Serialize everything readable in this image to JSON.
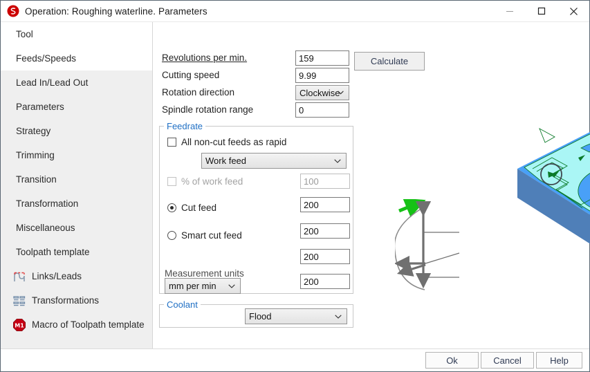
{
  "window": {
    "title": "Operation: Roughing waterline. Parameters",
    "icon": "app-logo-icon",
    "minimize": "–",
    "maximize": "□",
    "close": "✕"
  },
  "sidebar": {
    "items": [
      {
        "label": "Tool",
        "selected": false,
        "icon": null
      },
      {
        "label": "Feeds/Speeds",
        "selected": true,
        "icon": null
      },
      {
        "label": "Lead In/Lead Out",
        "selected": false,
        "icon": null
      },
      {
        "label": "Parameters",
        "selected": false,
        "icon": null
      },
      {
        "label": "Strategy",
        "selected": false,
        "icon": null
      },
      {
        "label": "Trimming",
        "selected": false,
        "icon": null
      },
      {
        "label": "Transition",
        "selected": false,
        "icon": null
      },
      {
        "label": "Transformation",
        "selected": false,
        "icon": null
      },
      {
        "label": "Miscellaneous",
        "selected": false,
        "icon": null
      },
      {
        "label": "Toolpath template",
        "selected": false,
        "icon": null
      },
      {
        "label": "Links/Leads",
        "selected": false,
        "icon": "links-leads-icon"
      },
      {
        "label": "Transformations",
        "selected": false,
        "icon": "transformations-icon"
      },
      {
        "label": "Macro of Toolpath template",
        "selected": false,
        "icon": "macro-m1-icon"
      }
    ]
  },
  "spindle": {
    "rpm_label": "Revolutions per min.",
    "rpm_value": "159",
    "cutting_speed_label": "Cutting speed",
    "cutting_speed_value": "9.99",
    "rotation_direction_label": "Rotation direction",
    "rotation_direction_value": "Clockwise",
    "spindle_range_label": "Spindle rotation range",
    "spindle_range_value": "0",
    "calculate_label": "Calculate"
  },
  "feedrate": {
    "group_title": "Feedrate",
    "all_non_cut_label": "All non-cut feeds as rapid",
    "all_non_cut_checked": false,
    "feed_type_value": "Work feed",
    "percent_of_work_feed_label": "% of work feed",
    "percent_of_work_feed_checked": false,
    "percent_of_work_feed_value": "100",
    "cut_feed_label": "Cut feed",
    "cut_feed_selected": true,
    "smart_cut_feed_label": "Smart cut feed",
    "smart_cut_feed_selected": false,
    "measurement_units_label": "Measurement units",
    "measurement_units_value": "mm per min",
    "feed_values": [
      "200",
      "200",
      "200",
      "200"
    ]
  },
  "coolant": {
    "group_title": "Coolant",
    "value": "Flood"
  },
  "footer": {
    "ok": "Ok",
    "cancel": "Cancel",
    "help": "Help"
  },
  "colors": {
    "accent_group_title": "#1f6fc4",
    "brand_red": "#cc0000",
    "stock_blue": "#3d90f0",
    "machined_cyan": "#aaf6f5",
    "toolpath_green": "#0a7a28",
    "rapid_red": "#ee1111"
  }
}
